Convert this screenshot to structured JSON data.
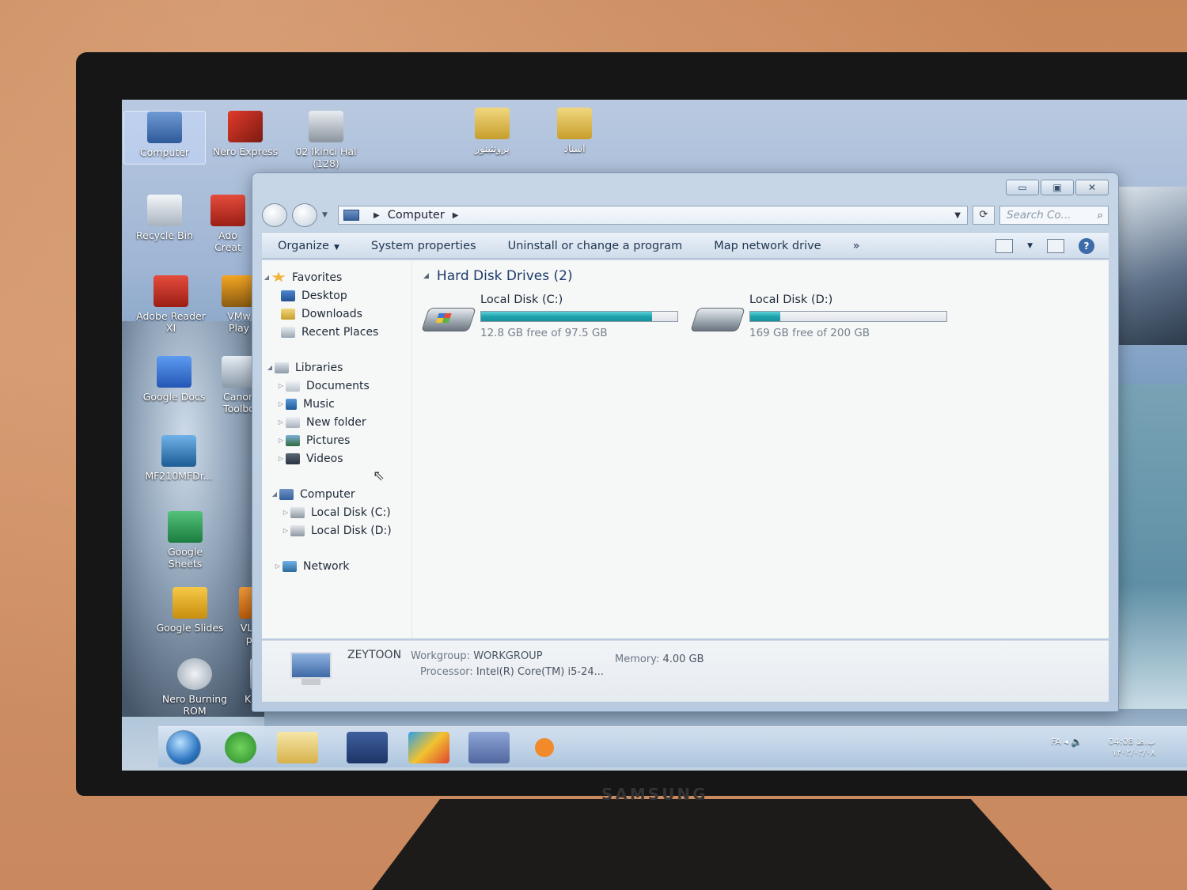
{
  "monitor": {
    "brand": "SAMSUNG"
  },
  "desktop": {
    "icons": [
      {
        "label": "Computer"
      },
      {
        "label": "Nero Express"
      },
      {
        "label": "02 Ikinci Hal",
        "label2": "(128)"
      },
      {
        "label": "پروتئینور"
      },
      {
        "label": "اسناد"
      },
      {
        "label": "Recycle Bin"
      },
      {
        "label": "Ado",
        "label2": "Creat"
      },
      {
        "label": "Adobe Reader",
        "label2": "XI"
      },
      {
        "label": "VMw",
        "label2": "Play"
      },
      {
        "label": "Google Docs"
      },
      {
        "label": "Canon",
        "label2": "Toolbo"
      },
      {
        "label": "MF210MFDr..."
      },
      {
        "label": "Google",
        "label2": "Sheets"
      },
      {
        "label": "Google Slides"
      },
      {
        "label": "VLC m",
        "label2": "play"
      },
      {
        "label": "Nero Burning",
        "label2": "ROM"
      },
      {
        "label": "KMPlayer"
      }
    ]
  },
  "window": {
    "caption": {
      "minimize": "▭",
      "maximize": "▣",
      "close": "✕"
    },
    "address": {
      "location": "Computer"
    },
    "search": {
      "placeholder": "Search Co..."
    },
    "toolbar": {
      "organize": "Organize",
      "system_properties": "System properties",
      "uninstall": "Uninstall or change a program",
      "map_drive": "Map network drive",
      "more": "»"
    },
    "nav": {
      "favorites": "Favorites",
      "desktop": "Desktop",
      "downloads": "Downloads",
      "recent": "Recent Places",
      "libraries": "Libraries",
      "documents": "Documents",
      "music": "Music",
      "new_folder": "New folder",
      "pictures": "Pictures",
      "videos": "Videos",
      "computer": "Computer",
      "local_c": "Local Disk (C:)",
      "local_d": "Local Disk (D:)",
      "network": "Network"
    },
    "group_title": "Hard Disk Drives (2)",
    "drives": [
      {
        "name": "Local Disk (C:)",
        "free_text": "12.8 GB free of 97.5 GB",
        "used_fraction": 0.869
      },
      {
        "name": "Local Disk (D:)",
        "free_text": "169 GB free of 200 GB",
        "used_fraction": 0.155
      }
    ],
    "details": {
      "computer_name": "ZEYTOON",
      "workgroup_label": "Workgroup:",
      "workgroup": "WORKGROUP",
      "memory_label": "Memory:",
      "memory": "4.00 GB",
      "processor_label": "Processor:",
      "processor": "Intel(R) Core(TM) i5-24..."
    }
  },
  "taskbar": {
    "lang": "FA",
    "time": "04:08 ب.ظ",
    "date": "۱۴۰۲/۰۲/۰۸"
  },
  "colors": {
    "drive_fill": "#1fa3ad",
    "accent": "#1e3a6a"
  }
}
